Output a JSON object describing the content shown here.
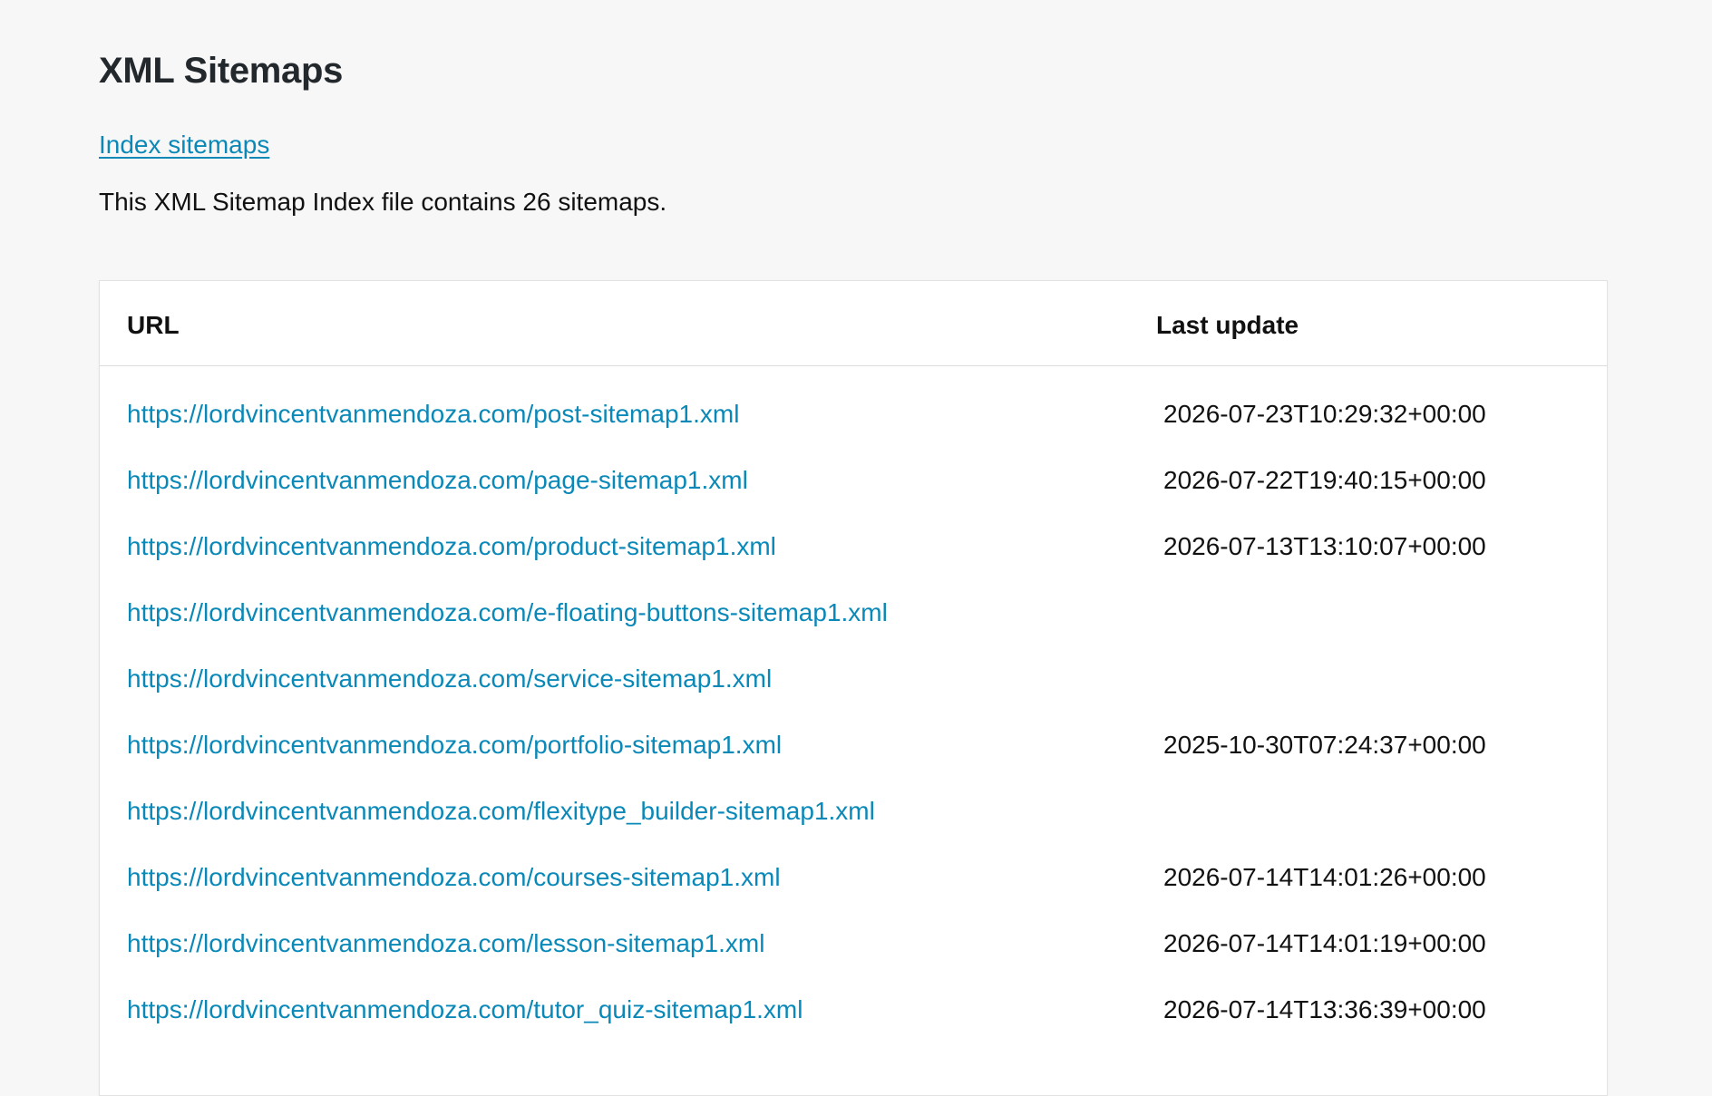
{
  "header": {
    "title": "XML Sitemaps",
    "index_link": "Index sitemaps",
    "summary": "This XML Sitemap Index file contains 26 sitemaps."
  },
  "table": {
    "columns": [
      "URL",
      "Last update"
    ],
    "rows": [
      {
        "url": "https://lordvincentvanmendoza.com/post-sitemap1.xml",
        "last_update": "2026-07-23T10:29:32+00:00"
      },
      {
        "url": "https://lordvincentvanmendoza.com/page-sitemap1.xml",
        "last_update": "2026-07-22T19:40:15+00:00"
      },
      {
        "url": "https://lordvincentvanmendoza.com/product-sitemap1.xml",
        "last_update": "2026-07-13T13:10:07+00:00"
      },
      {
        "url": "https://lordvincentvanmendoza.com/e-floating-buttons-sitemap1.xml",
        "last_update": ""
      },
      {
        "url": "https://lordvincentvanmendoza.com/service-sitemap1.xml",
        "last_update": ""
      },
      {
        "url": "https://lordvincentvanmendoza.com/portfolio-sitemap1.xml",
        "last_update": "2025-10-30T07:24:37+00:00"
      },
      {
        "url": "https://lordvincentvanmendoza.com/flexitype_builder-sitemap1.xml",
        "last_update": ""
      },
      {
        "url": "https://lordvincentvanmendoza.com/courses-sitemap1.xml",
        "last_update": "2026-07-14T14:01:26+00:00"
      },
      {
        "url": "https://lordvincentvanmendoza.com/lesson-sitemap1.xml",
        "last_update": "2026-07-14T14:01:19+00:00"
      },
      {
        "url": "https://lordvincentvanmendoza.com/tutor_quiz-sitemap1.xml",
        "last_update": "2026-07-14T13:36:39+00:00"
      }
    ]
  },
  "colors": {
    "link": "#0a89b8",
    "background": "#f7f7f7",
    "card": "#ffffff"
  }
}
